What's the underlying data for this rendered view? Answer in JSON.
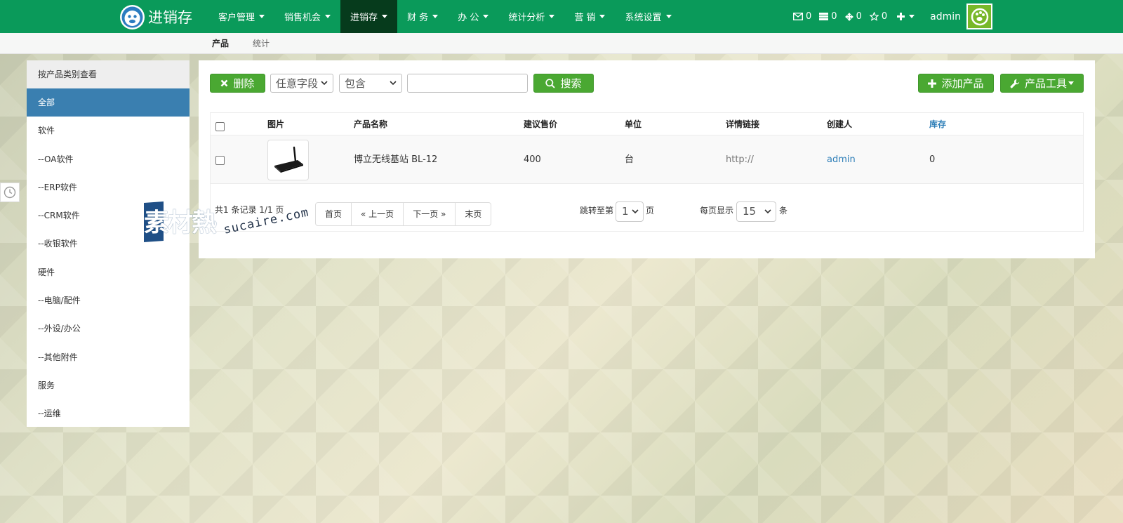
{
  "app": {
    "title": "进销存"
  },
  "nav": {
    "menu": [
      {
        "label": "客户管理",
        "active": false
      },
      {
        "label": "销售机会",
        "active": false
      },
      {
        "label": "进销存",
        "active": true
      },
      {
        "label": "财 务",
        "active": false
      },
      {
        "label": "办 公",
        "active": false
      },
      {
        "label": "统计分析",
        "active": false
      },
      {
        "label": "营 销",
        "active": false
      },
      {
        "label": "系统设置",
        "active": false
      }
    ],
    "counters": {
      "mail": "0",
      "tasks": "0",
      "messages": "0",
      "favorites": "0"
    },
    "user": "admin"
  },
  "subnav": {
    "tabs": [
      {
        "label": "产品",
        "active": true
      },
      {
        "label": "统计",
        "active": false
      }
    ]
  },
  "sidebar": {
    "header": "按产品类别查看",
    "items": [
      {
        "label": "全部",
        "active": true
      },
      {
        "label": "软件",
        "active": false
      },
      {
        "label": "--OA软件",
        "active": false
      },
      {
        "label": "--ERP软件",
        "active": false
      },
      {
        "label": "--CRM软件",
        "active": false
      },
      {
        "label": "--收银软件",
        "active": false
      },
      {
        "label": "硬件",
        "active": false
      },
      {
        "label": "--电脑/配件",
        "active": false
      },
      {
        "label": "--外设/办公",
        "active": false
      },
      {
        "label": "--其他附件",
        "active": false
      },
      {
        "label": "服务",
        "active": false
      },
      {
        "label": "--运维",
        "active": false
      }
    ]
  },
  "toolbar": {
    "delete_label": "删除",
    "field_select": "任意字段",
    "condition_select": "包含",
    "search_value": "",
    "search_label": "搜索",
    "add_label": "添加产品",
    "tools_label": "产品工具"
  },
  "table": {
    "headers": {
      "image": "图片",
      "name": "产品名称",
      "price": "建议售价",
      "unit": "单位",
      "link": "详情链接",
      "creator": "创建人",
      "stock": "库存"
    },
    "rows": [
      {
        "name": "博立无线基站 BL-12",
        "price": "400",
        "unit": "台",
        "link": "http://",
        "creator": "admin",
        "stock": "0"
      }
    ]
  },
  "pagination": {
    "summary": "共1 条记录 1/1 页",
    "first": "首页",
    "prev": "« 上一页",
    "next": "下一页 »",
    "last": "末页",
    "jump_prefix": "跳转至第",
    "jump_value": "1",
    "jump_suffix": "页",
    "per_page_prefix": "每页显示",
    "per_page_value": "15",
    "per_page_suffix": "条"
  },
  "watermark": {
    "logo": "素材熱",
    "url": "sucaire.com"
  },
  "colors": {
    "nav_bg": "#0a9a5a",
    "nav_active": "#063b1c",
    "button_green": "#4aa832",
    "sidebar_active": "#3a7fb0",
    "link_blue": "#2f7fb8"
  }
}
